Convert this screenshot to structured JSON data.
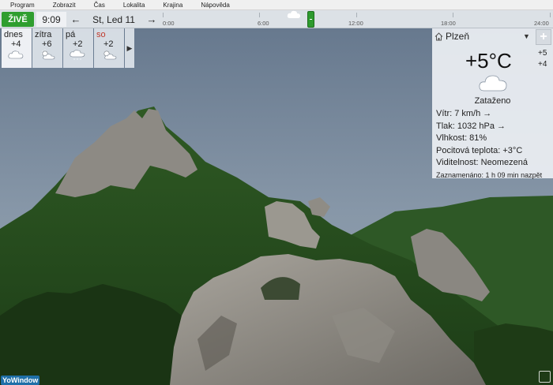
{
  "menu": [
    "Program",
    "Zobrazit",
    "Čas",
    "Lokalita",
    "Krajina",
    "Nápověda"
  ],
  "timebar": {
    "live_label": "ŽIVĚ",
    "clock": "9:09",
    "prev_arrow": "←",
    "next_arrow": "→",
    "date": "St, Led 11",
    "ticks": [
      "0:00",
      "6:00",
      "12:00",
      "18:00",
      "24:00"
    ]
  },
  "forecast": [
    {
      "name": "dnes",
      "temp": "+4",
      "icon": "cloud-icon",
      "weekend": false
    },
    {
      "name": "zítra",
      "temp": "+6",
      "icon": "partly-sunny-icon",
      "weekend": false
    },
    {
      "name": "pá",
      "temp": "+2",
      "icon": "rain-cloud-icon",
      "weekend": false
    },
    {
      "name": "so",
      "temp": "+2",
      "icon": "partly-sunny-icon",
      "weekend": true
    }
  ],
  "forecast_more": "▶",
  "panel": {
    "location": "Plzeň",
    "dropdown": "▼",
    "add": "+",
    "temperature": "+5°C",
    "max": "+5",
    "min": "+4",
    "condition": "Zataženo",
    "wind": "Vítr:  7 km/h  →",
    "pressure": "Tlak:  1032 hPa  →",
    "humidity": "Vlhkost:  81%",
    "feels_like": "Pocitová teplota:  +3°C",
    "visibility": "Viditelnost:  Neomezená",
    "recorded": "Zaznamenáno:  1 h 09 min nazpět"
  },
  "brand": "YoWindow",
  "colors": {
    "live": "#2f9e2f",
    "weekend": "#c0392b",
    "sky": "#74879b"
  }
}
